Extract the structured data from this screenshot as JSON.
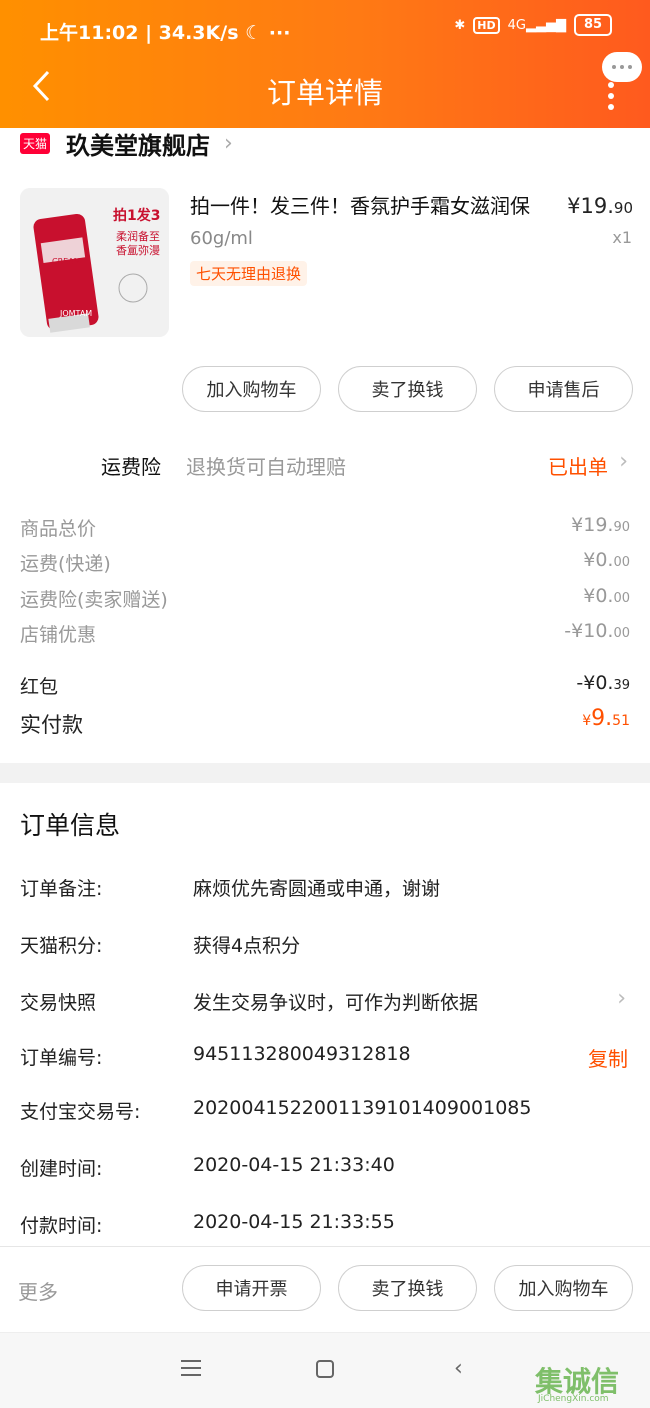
{
  "status_bar": {
    "time_speed": "上午11:02 | 34.3K/s ☾  ···",
    "hd": "HD",
    "network": "4G",
    "battery": "85"
  },
  "nav": {
    "title": "订单详情"
  },
  "shop": {
    "badge": "天猫",
    "name": "玖美堂旗舰店"
  },
  "product": {
    "title": "拍一件！发三件！香氛护手霜女滋润保",
    "price_int": "¥19.",
    "price_dec": "90",
    "spec": "60g/ml",
    "qty": "x1",
    "badge": "七天无理由退换",
    "thumb_lines": [
      "拍1发3",
      "柔润备至",
      "香氲弥漫",
      "CREAM",
      "JOMTAM"
    ]
  },
  "actions": [
    "加入购物车",
    "卖了换钱",
    "申请售后"
  ],
  "insurance": {
    "label": "运费险",
    "desc": "退换货可自动理赔",
    "status": "已出单"
  },
  "price_rows": [
    {
      "label": "商品总价",
      "main": "¥19.",
      "dec": "90"
    },
    {
      "label": "运费(快递)",
      "main": "¥0.",
      "dec": "00"
    },
    {
      "label": "运费险(卖家赠送)",
      "main": "¥0.",
      "dec": "00"
    },
    {
      "label": "店铺优惠",
      "main": "-¥10.",
      "dec": "00"
    },
    {
      "label": "红包",
      "main": "-¥0.",
      "dec": "39"
    }
  ],
  "paid": {
    "label": "实付款",
    "currency": "¥",
    "main": "9.",
    "dec": "51"
  },
  "order_info": {
    "heading": "订单信息",
    "rows": [
      {
        "label": "订单备注:",
        "value": "麻烦优先寄圆通或申通，谢谢"
      },
      {
        "label": "天猫积分:",
        "value": "获得4点积分"
      },
      {
        "label": "交易快照",
        "value": "发生交易争议时，可作为判断依据"
      },
      {
        "label": "订单编号:",
        "value": "945113280049312818"
      },
      {
        "label": "支付宝交易号:",
        "value": "2020041522001139101409001085"
      },
      {
        "label": "创建时间:",
        "value": "2020-04-15 21:33:40"
      },
      {
        "label": "付款时间:",
        "value": "2020-04-15 21:33:55"
      }
    ],
    "copy": "复制"
  },
  "bottom": {
    "more": "更多",
    "buttons": [
      "申请开票",
      "卖了换钱",
      "加入购物车"
    ]
  },
  "watermark": {
    "logo": "集诚信",
    "site": "JiChengXin.com"
  },
  "colors": {
    "accent": "#ff5000",
    "header_start": "#ff9000",
    "header_end": "#ff5a1e"
  }
}
